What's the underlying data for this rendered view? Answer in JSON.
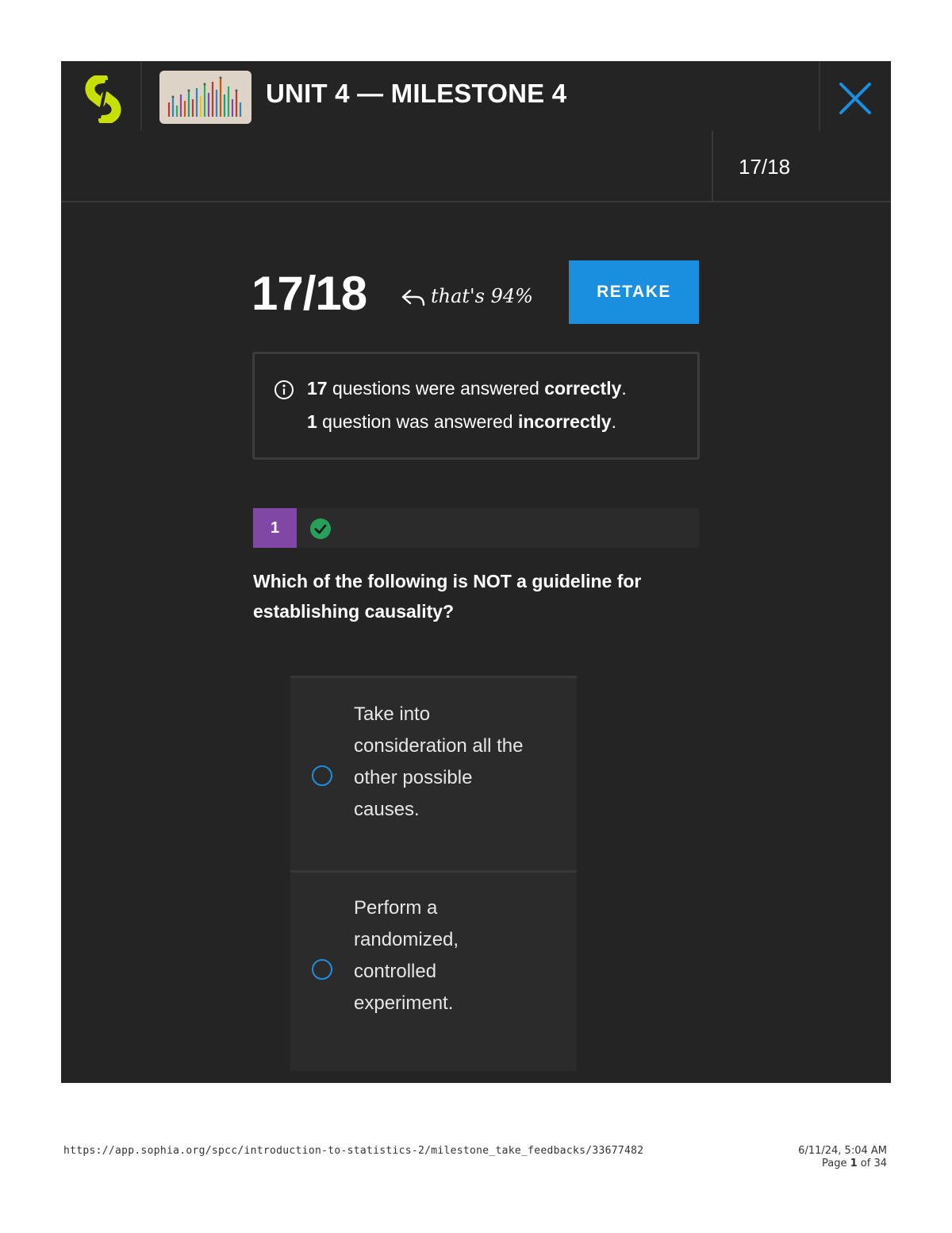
{
  "header": {
    "title": "UNIT 4 — MILESTONE 4",
    "brand_color": "#c8e000"
  },
  "subheader": {
    "progress": "17/18"
  },
  "result": {
    "score": "17/18",
    "percent_note": "that's 94%",
    "retake_label": "RETAKE",
    "accent_color": "#1a8fe0"
  },
  "summary": {
    "correct_count": "17",
    "correct_mid": " questions were answered ",
    "correct_word": "correctly",
    "correct_end": ".",
    "incorrect_count": "1",
    "incorrect_mid": " question was answered ",
    "incorrect_word": "incorrectly",
    "incorrect_end": "."
  },
  "question": {
    "number": "1",
    "status": "correct",
    "text": "Which of the following is NOT a guideline for establishing causality?",
    "options": [
      {
        "lines": [
          "Take into",
          "consideration all the",
          "other possible",
          "causes."
        ]
      },
      {
        "lines": [
          "Perform a",
          "randomized,",
          "controlled",
          "experiment."
        ]
      }
    ]
  },
  "footer": {
    "url": "https://app.sophia.org/spcc/introduction-to-statistics-2/milestone_take_feedbacks/33677482",
    "datetime": "6/11/24, 5:04 AM",
    "page_prefix": "Page ",
    "page_current": "1",
    "page_mid": " of ",
    "page_total": "34"
  }
}
